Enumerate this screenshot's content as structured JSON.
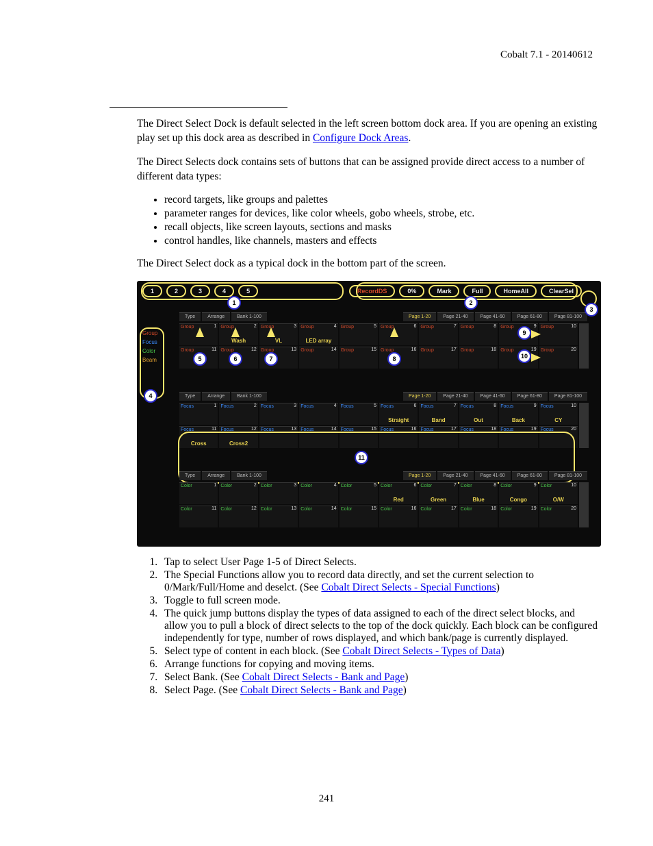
{
  "header": "Cobalt 7.1 - 20140612",
  "page_number": "241",
  "para1a": "The Direct Select Dock is default selected in the left screen bottom dock area. If you are opening an existing play set up this dock area as described in ",
  "link1": "Configure Dock Areas",
  "para1b": ".",
  "para2": "The Direct Selects dock contains sets of buttons that can be assigned provide direct access to a number of different data types:",
  "bullets": [
    "record targets, like groups and palettes",
    "parameter ranges for devices, like color wheels, gobo wheels, strobe, etc.",
    "recall objects, like screen layouts, sections and masks",
    "control handles, like channels, masters and effects"
  ],
  "para3": "The Direct Select dock as a typical dock in the bottom part of the screen.",
  "list": [
    {
      "t": "Tap to select User Page 1-5 of Direct Selects."
    },
    {
      "t": "The Special Functions allow you to record data directly, and set the current selection to 0/Mark/Full/Home and deselct. (See ",
      "l": "Cobalt Direct Selects - Special Functions",
      "a": ")"
    },
    {
      "t": "Toggle to full screen mode."
    },
    {
      "t": "The quick jump buttons display the types of data assigned to each of the direct select blocks, and allow you to pull a block of direct selects to the top of the dock quickly. Each block can be configured independently for type, number of rows displayed, and which bank/page is currently displayed."
    },
    {
      "t": "Select type of content in each block. (See ",
      "l": "Cobalt Direct Selects - Types of Data",
      "a": ")"
    },
    {
      "t": "Arrange functions for copying and moving items."
    },
    {
      "t": "Select Bank. (See ",
      "l": "Cobalt Direct Selects - Bank and Page",
      "a": ")"
    },
    {
      "t": "Select Page. (See ",
      "l": "Cobalt Direct Selects - Bank and Page",
      "a": ")"
    }
  ],
  "fig": {
    "tabs": [
      "1",
      "2",
      "3",
      "4",
      "5"
    ],
    "fns": [
      "RecordDS",
      "0%",
      "Mark",
      "Full",
      "HomeAll",
      "ClearSel"
    ],
    "sidebar": [
      "Group",
      "Focus",
      "Color",
      "Beam"
    ],
    "hdr": {
      "type": "Type",
      "arrange": "Arrange",
      "bank": "Bank 1-100",
      "pages": [
        "Page 1-20",
        "Page 21-40",
        "Page 41-60",
        "Page 61-80",
        "Page 81-100"
      ]
    },
    "block1": {
      "label": "Group",
      "color": "c-red",
      "cells": [
        {
          "n": "1",
          "t": "",
          "b": ""
        },
        {
          "n": "2",
          "t": "",
          "b": "Wash"
        },
        {
          "n": "3",
          "t": "",
          "b": "VL"
        },
        {
          "n": "4",
          "t": "",
          "b": "LED array"
        },
        {
          "n": "5",
          "t": "",
          "b": ""
        },
        {
          "n": "6",
          "t": "",
          "b": ""
        },
        {
          "n": "7",
          "t": "",
          "b": ""
        },
        {
          "n": "8",
          "t": "",
          "b": ""
        },
        {
          "n": "9",
          "t": "",
          "b": ""
        },
        {
          "n": "10",
          "t": "",
          "b": ""
        },
        {
          "n": "11",
          "t": "",
          "b": ""
        },
        {
          "n": "12",
          "t": "",
          "b": ""
        },
        {
          "n": "13",
          "t": "",
          "b": ""
        },
        {
          "n": "14",
          "t": "",
          "b": ""
        },
        {
          "n": "15",
          "t": "",
          "b": ""
        },
        {
          "n": "16",
          "t": "",
          "b": ""
        },
        {
          "n": "17",
          "t": "",
          "b": ""
        },
        {
          "n": "18",
          "t": "",
          "b": ""
        },
        {
          "n": "19",
          "t": "",
          "b": ""
        },
        {
          "n": "20",
          "t": "",
          "b": ""
        }
      ]
    },
    "block2": {
      "label": "Focus",
      "color": "c-blue",
      "cells": [
        {
          "n": "1",
          "t": "Focus",
          "b": ""
        },
        {
          "n": "2",
          "t": "Focus",
          "b": ""
        },
        {
          "n": "3",
          "t": "Focus",
          "b": ""
        },
        {
          "n": "4",
          "t": "Focus",
          "b": ""
        },
        {
          "n": "5",
          "t": "Focus",
          "b": ""
        },
        {
          "n": "6",
          "t": "Focus",
          "b": "Straight"
        },
        {
          "n": "7",
          "t": "Focus",
          "b": "Band"
        },
        {
          "n": "8",
          "t": "Focus",
          "b": "Out"
        },
        {
          "n": "9",
          "t": "Focus",
          "b": "Back"
        },
        {
          "n": "10",
          "t": "Focus",
          "b": "CY"
        },
        {
          "n": "11",
          "t": "Focus",
          "b": "Cross"
        },
        {
          "n": "12",
          "t": "Focus",
          "b": "Cross2"
        },
        {
          "n": "13",
          "t": "Focus",
          "b": ""
        },
        {
          "n": "14",
          "t": "Focus",
          "b": ""
        },
        {
          "n": "15",
          "t": "Focus",
          "b": ""
        },
        {
          "n": "16",
          "t": "Focus",
          "b": ""
        },
        {
          "n": "17",
          "t": "Focus",
          "b": ""
        },
        {
          "n": "18",
          "t": "Focus",
          "b": ""
        },
        {
          "n": "19",
          "t": "Focus",
          "b": ""
        },
        {
          "n": "20",
          "t": "Focus",
          "b": ""
        }
      ]
    },
    "block3": {
      "label": "Color",
      "color": "c-green",
      "cells": [
        {
          "n": "1",
          "t": "Color",
          "b": ""
        },
        {
          "n": "2",
          "t": "Color",
          "b": ""
        },
        {
          "n": "3",
          "t": "Color",
          "b": ""
        },
        {
          "n": "4",
          "t": "Color",
          "b": ""
        },
        {
          "n": "5",
          "t": "Color",
          "b": ""
        },
        {
          "n": "6",
          "t": "Color",
          "b": "Red"
        },
        {
          "n": "7",
          "t": "Color",
          "b": "Green"
        },
        {
          "n": "8",
          "t": "Color",
          "b": "Blue"
        },
        {
          "n": "9",
          "t": "Color",
          "b": "Congo"
        },
        {
          "n": "10",
          "t": "Color",
          "b": "O/W"
        },
        {
          "n": "11",
          "t": "Color",
          "b": ""
        },
        {
          "n": "12",
          "t": "Color",
          "b": ""
        },
        {
          "n": "13",
          "t": "Color",
          "b": ""
        },
        {
          "n": "14",
          "t": "Color",
          "b": ""
        },
        {
          "n": "15",
          "t": "Color",
          "b": ""
        },
        {
          "n": "16",
          "t": "Color",
          "b": ""
        },
        {
          "n": "17",
          "t": "Color",
          "b": ""
        },
        {
          "n": "18",
          "t": "Color",
          "b": ""
        },
        {
          "n": "19",
          "t": "Color",
          "b": ""
        },
        {
          "n": "20",
          "t": "Color",
          "b": ""
        }
      ]
    },
    "callouts": {
      "1": "1",
      "2": "2",
      "3": "3",
      "4": "4",
      "5": "5",
      "6": "6",
      "7": "7",
      "8": "8",
      "9": "9",
      "10": "10",
      "11": "11"
    }
  }
}
